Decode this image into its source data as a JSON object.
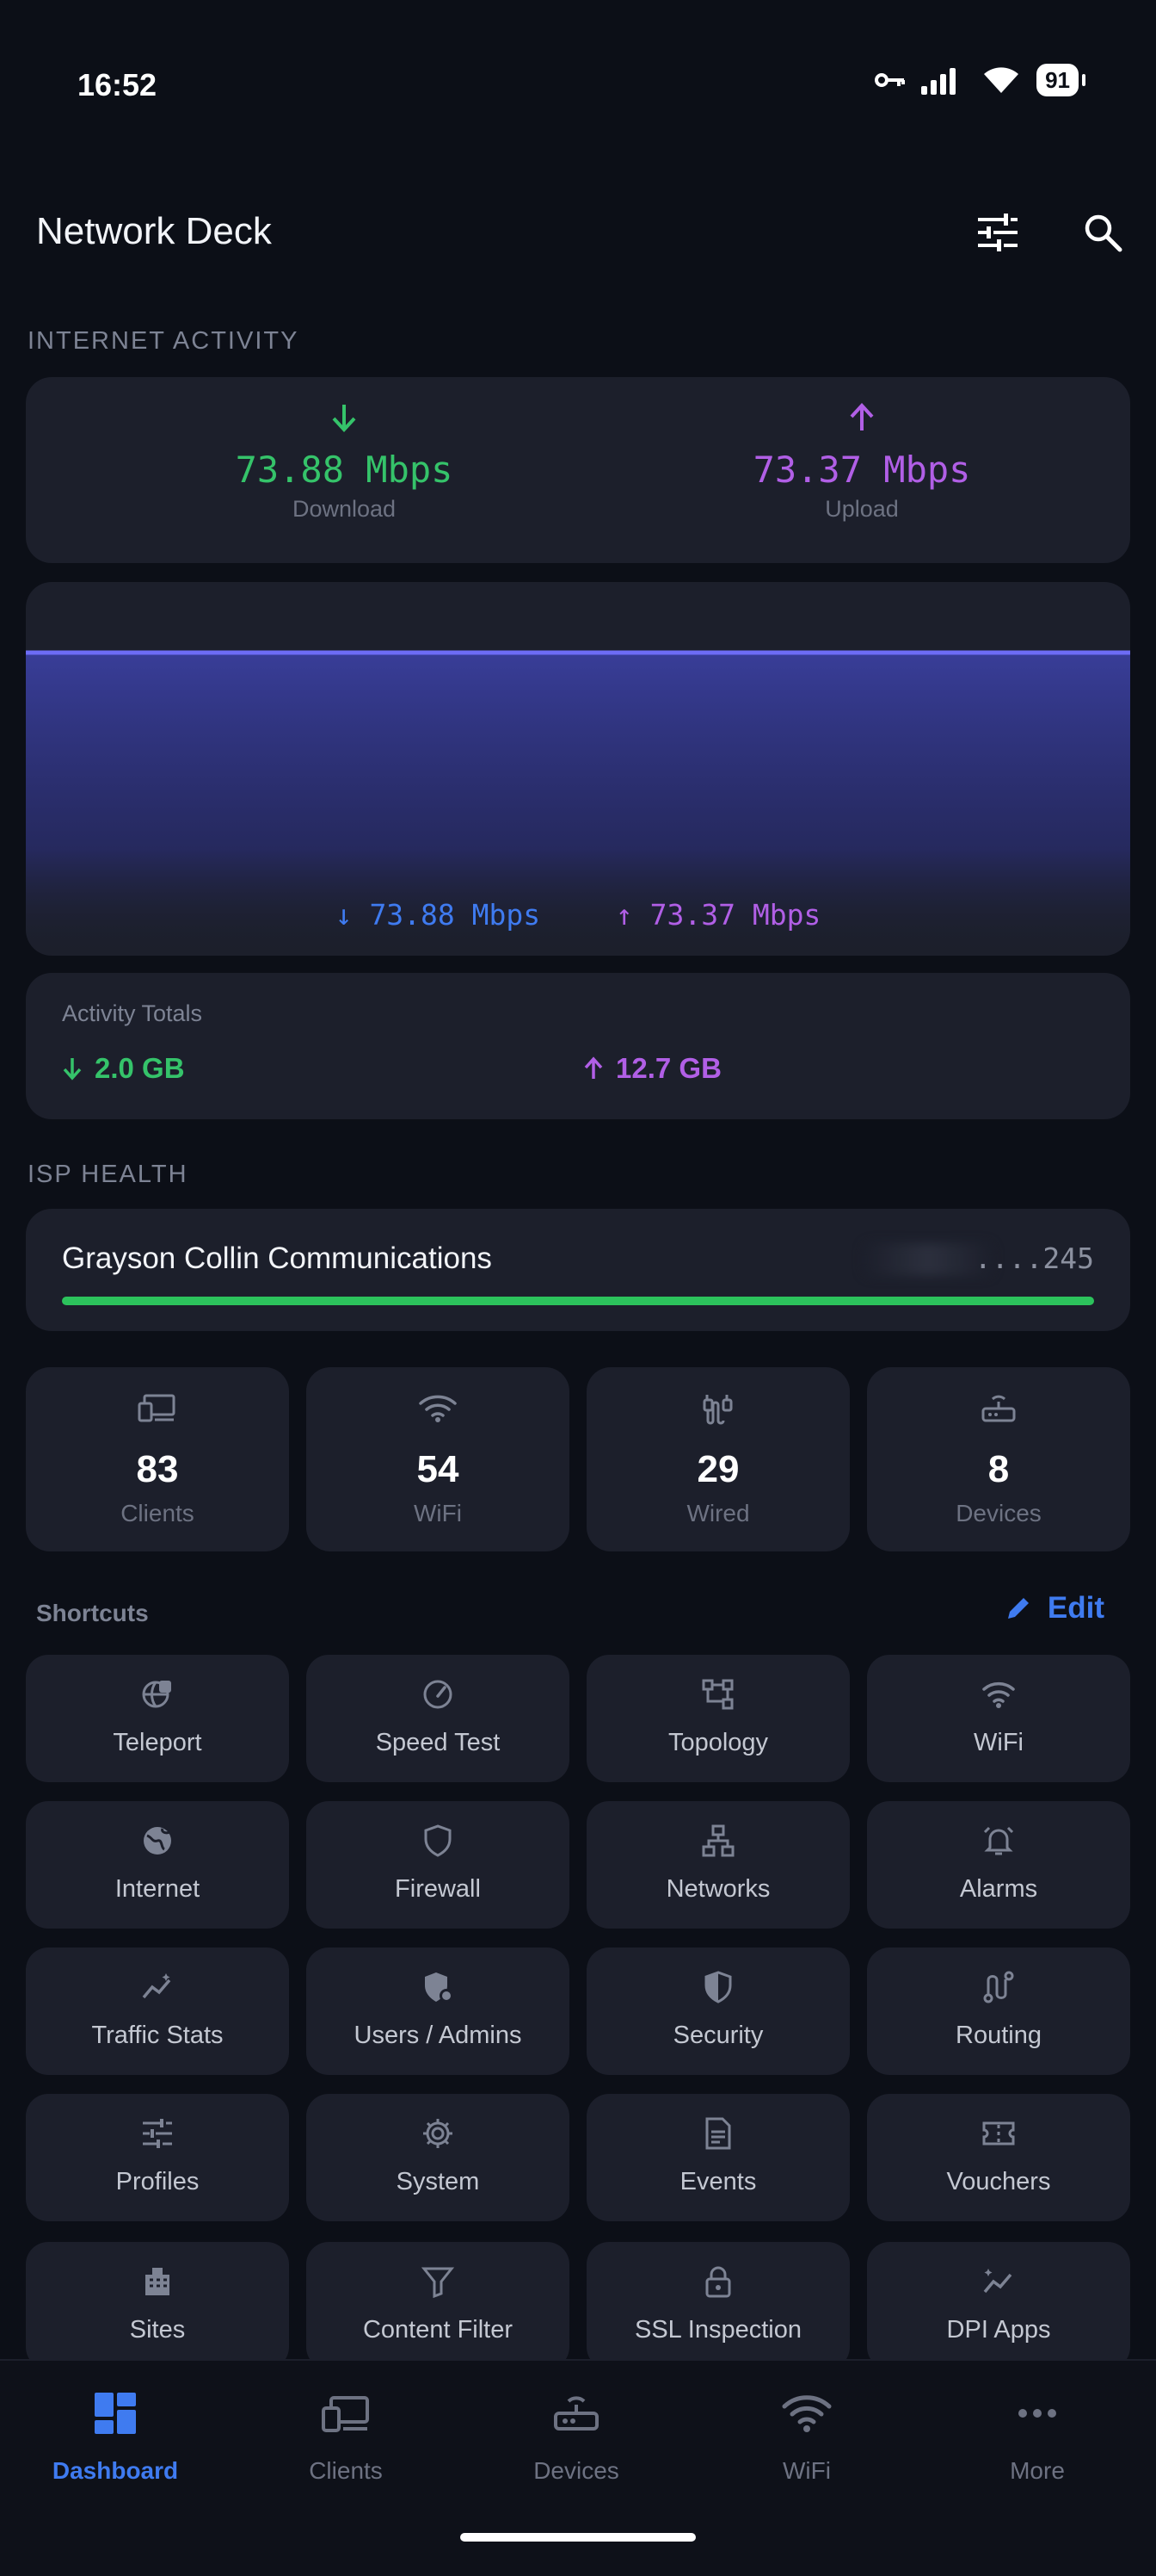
{
  "status": {
    "time": "16:52",
    "battery": "91"
  },
  "header": {
    "title": "Network Deck"
  },
  "activity": {
    "section_label": "INTERNET ACTIVITY",
    "download_value": "73.88 Mbps",
    "download_caption": "Download",
    "upload_value": "73.37 Mbps",
    "upload_caption": "Upload",
    "chart_download": "73.88 Mbps",
    "chart_upload": "73.37 Mbps",
    "totals_title": "Activity Totals",
    "total_download": "2.0 GB",
    "total_upload": "12.7 GB"
  },
  "isp": {
    "section_label": "ISP HEALTH",
    "name": "Grayson Collin Communications",
    "ip_suffix": "....245",
    "health_percent": 100
  },
  "stats": [
    {
      "value": "83",
      "label": "Clients",
      "icon": "clients-icon"
    },
    {
      "value": "54",
      "label": "WiFi",
      "icon": "wifi-icon"
    },
    {
      "value": "29",
      "label": "Wired",
      "icon": "wired-icon"
    },
    {
      "value": "8",
      "label": "Devices",
      "icon": "router-icon"
    }
  ],
  "shortcuts": {
    "title": "Shortcuts",
    "edit_label": "Edit",
    "items": [
      {
        "label": "Teleport",
        "icon": "teleport-icon"
      },
      {
        "label": "Speed Test",
        "icon": "speedometer-icon"
      },
      {
        "label": "Topology",
        "icon": "topology-icon"
      },
      {
        "label": "WiFi",
        "icon": "wifi-icon"
      },
      {
        "label": "Internet",
        "icon": "globe-icon"
      },
      {
        "label": "Firewall",
        "icon": "shield-icon"
      },
      {
        "label": "Networks",
        "icon": "network-icon"
      },
      {
        "label": "Alarms",
        "icon": "alarm-bell-icon"
      },
      {
        "label": "Traffic Stats",
        "icon": "traffic-stats-icon"
      },
      {
        "label": "Users / Admins",
        "icon": "admin-shield-icon"
      },
      {
        "label": "Security",
        "icon": "security-shield-icon"
      },
      {
        "label": "Routing",
        "icon": "routing-icon"
      },
      {
        "label": "Profiles",
        "icon": "sliders-icon"
      },
      {
        "label": "System",
        "icon": "gear-icon"
      },
      {
        "label": "Events",
        "icon": "document-icon"
      },
      {
        "label": "Vouchers",
        "icon": "ticket-icon"
      },
      {
        "label": "Sites",
        "icon": "building-icon"
      },
      {
        "label": "Content Filter",
        "icon": "filter-icon"
      },
      {
        "label": "SSL Inspection",
        "icon": "lock-icon"
      },
      {
        "label": "DPI Apps",
        "icon": "dpi-chart-icon"
      }
    ]
  },
  "nav": {
    "items": [
      {
        "label": "Dashboard",
        "icon": "dashboard-icon",
        "active": true
      },
      {
        "label": "Clients",
        "icon": "clients-icon",
        "active": false
      },
      {
        "label": "Devices",
        "icon": "router-icon",
        "active": false
      },
      {
        "label": "WiFi",
        "icon": "wifi-icon",
        "active": false
      },
      {
        "label": "More",
        "icon": "more-dots-icon",
        "active": false
      }
    ]
  },
  "colors": {
    "download": "#35c36a",
    "upload": "#b15fe6",
    "accent": "#3f7bf0",
    "health": "#2cc25c"
  }
}
